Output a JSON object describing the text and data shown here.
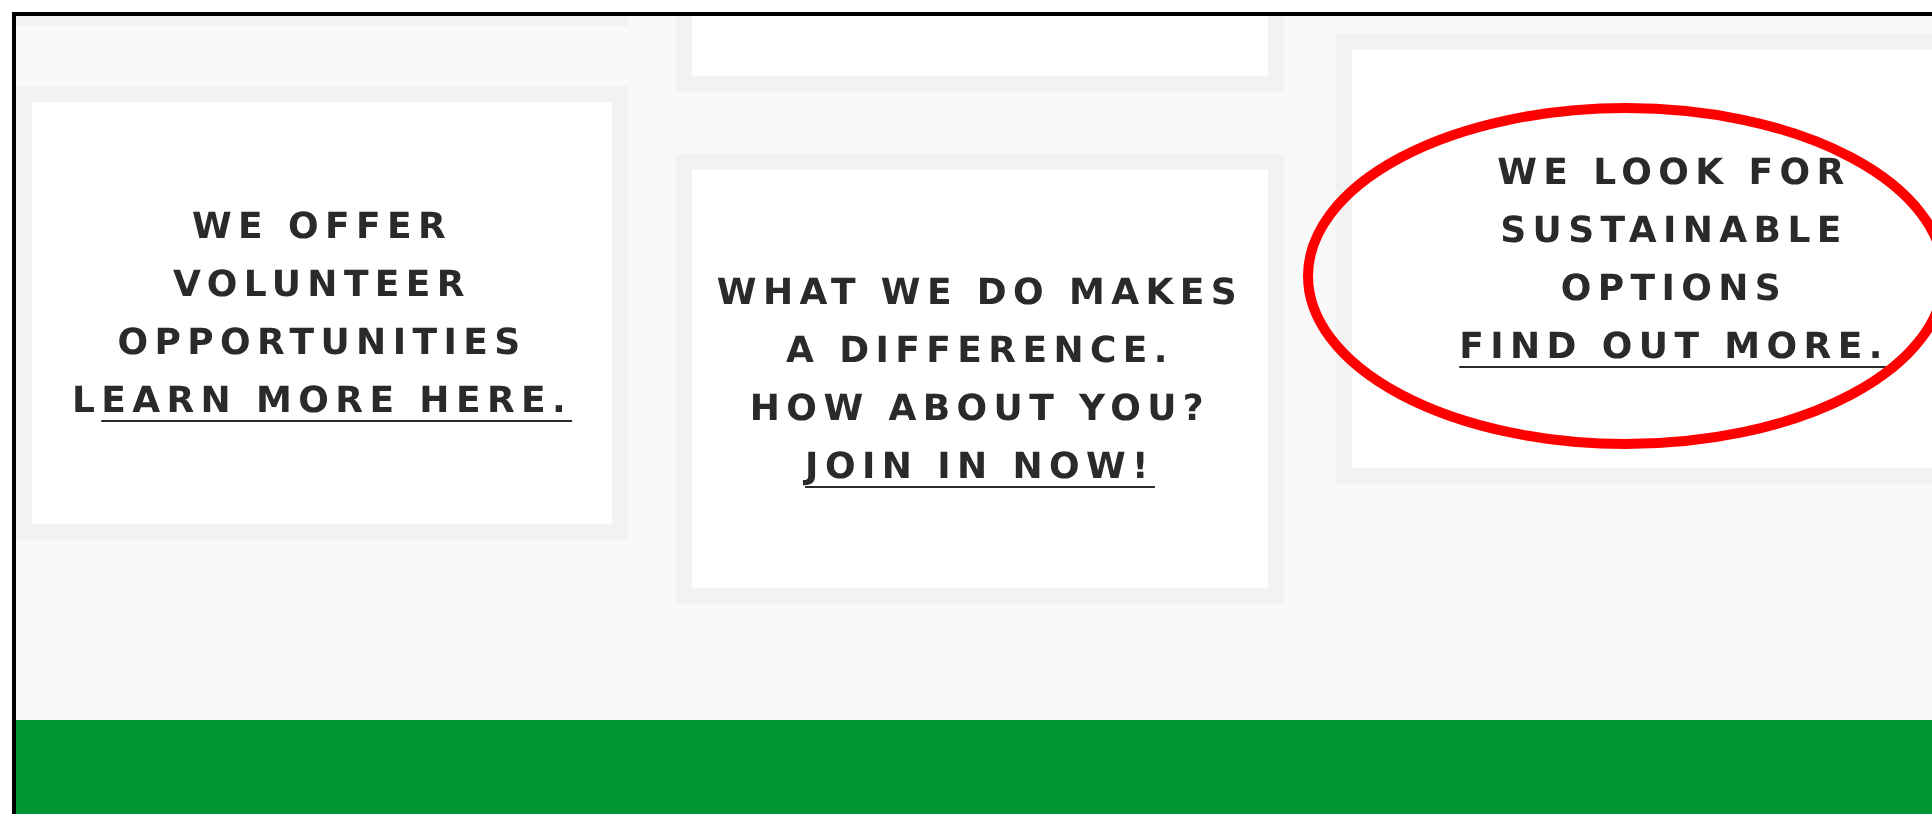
{
  "cards": [
    {
      "lines": [
        "WE OFFER",
        "VOLUNTEER",
        "OPPORTUNITIES"
      ],
      "link_prefix": "L",
      "link": "EARN MORE HERE.",
      "circled": false
    },
    {
      "lines": [
        "WHAT WE DO MAKES",
        "A DIFFERENCE.",
        "HOW ABOUT YOU?"
      ],
      "link": "JOIN IN NOW!",
      "circled": false
    },
    {
      "lines": [
        "WE LOOK FOR",
        "SUSTAINABLE",
        "OPTIONS"
      ],
      "link": "FIND OUT MORE.",
      "circled": true
    }
  ],
  "footer": {
    "color": "#009535"
  }
}
